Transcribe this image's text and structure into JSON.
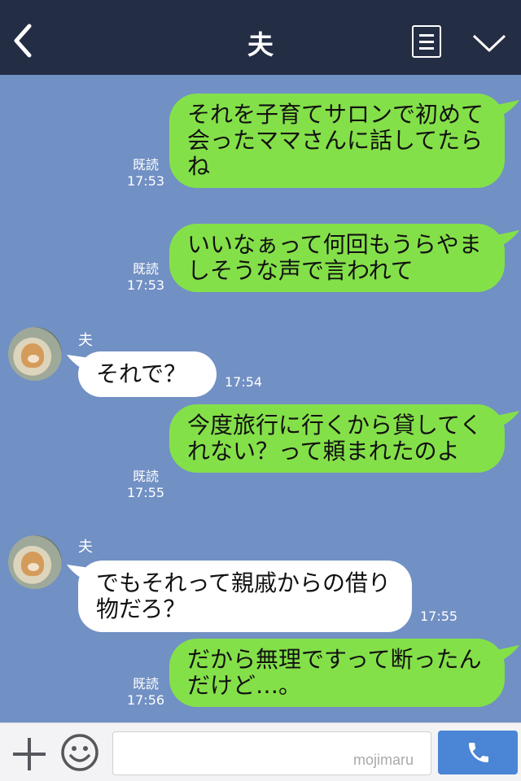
{
  "header": {
    "title": "夫"
  },
  "messages": [
    {
      "text": "それを子育てサロンで初めて会ったママさんに話してたらね",
      "read": "既読",
      "time": "17:53"
    },
    {
      "text": "いいなぁって何回もうらやましそうな声で言われて",
      "read": "既読",
      "time": "17:53"
    },
    {
      "sender": "夫",
      "text": "それで？",
      "time": "17:54"
    },
    {
      "text": "今度旅行に行くから貸してくれない？って頼まれたのよ",
      "read": "既読",
      "time": "17:55"
    },
    {
      "sender": "夫",
      "text": "でもそれって親戚からの借り物だろ？",
      "time": "17:55"
    },
    {
      "text": "だから無理ですって断ったんだけど…。",
      "read": "既読",
      "time": "17:56"
    }
  ],
  "watermark": "mojimaru",
  "colors": {
    "header": "#232d44",
    "background": "#7190c4",
    "outgoing": "#84e049",
    "incoming": "#ffffff",
    "send": "#4b85d6"
  }
}
